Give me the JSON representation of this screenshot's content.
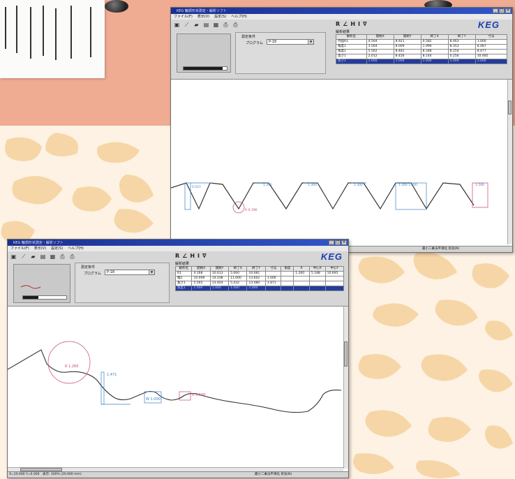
{
  "window_back": {
    "title": "KEG 輪郭形状測定・解析ソフト",
    "controls": [
      "_",
      "□",
      "×"
    ],
    "menu": [
      "ファイル(F)",
      "表示(V)",
      "設定(S)",
      "ヘルプ(H)"
    ],
    "conditions_label": "測定条件",
    "program_label": "プログラム",
    "program_value": "P-18",
    "analysis_label": "解析結果",
    "logo": "KEG",
    "tool_icons": [
      "R",
      "∠",
      "H",
      "I",
      "∇"
    ],
    "table": {
      "headers": [
        "解析名",
        "開始X",
        "開始Y",
        "終了X",
        "終了Y",
        "寸法"
      ],
      "rows": [
        [
          "円弧R1",
          "4.564",
          "8.921",
          "0.582",
          "8.463",
          "1.000"
        ],
        [
          "角度1",
          "3.564",
          "8.009",
          "1.990",
          "8.353",
          "8.487"
        ],
        [
          "角度2",
          "5.562",
          "8.481",
          "8.348",
          "8.254",
          "8.477"
        ],
        [
          "高さ1",
          "2.012",
          "8.456",
          "8.144",
          "0.256",
          "10.485"
        ],
        [
          "長さ1",
          "1.000",
          "1.000",
          "1.000",
          "1.000",
          "1.000"
        ]
      ]
    },
    "status": "最小二乗法平滑化 有効(N)",
    "labels": [
      "0.527",
      "1.300",
      "1.300",
      "1.300",
      "1.300",
      "1.500",
      "1.500",
      "R 0.196"
    ],
    "progress": 0.9
  },
  "window_front": {
    "title": "KEG 輪郭形状測定・解析ソフト",
    "controls": [
      "_",
      "□",
      "×"
    ],
    "menu": [
      "ファイル(F)",
      "表示(V)",
      "設定(S)",
      "ヘルプ(H)"
    ],
    "conditions_label": "測定条件",
    "program_label": "プログラム",
    "program_value": "P-18",
    "analysis_label": "解析結果",
    "logo": "KEG",
    "tool_icons": [
      "R",
      "∠",
      "H",
      "I",
      "∇"
    ],
    "table": {
      "headers": [
        "解析名",
        "開始X",
        "開始Y",
        "終了X",
        "終了Y",
        "寸法",
        "角度",
        "R",
        "中心X",
        "中心Y"
      ],
      "rows": [
        [
          "R1",
          "4.168",
          "10.613",
          "5.060",
          "10.681",
          "",
          "",
          "1.260",
          "5.188",
          "10.695"
        ],
        [
          "幅1",
          "10.008",
          "14.108",
          "11.000",
          "13.602",
          "1.000",
          "",
          "",
          "",
          ""
        ],
        [
          "長さ1",
          "5.565",
          "13.403",
          "5.432",
          "13.480",
          "1.871",
          "",
          "",
          "",
          ""
        ],
        [
          "角度1",
          "1.000",
          "1.000",
          "1.000",
          "1.000",
          "",
          "",
          "",
          "",
          ""
        ]
      ]
    },
    "status_left": [
      "X=10.000 Y=0.000",
      "表示: 100% (20.000 mm)"
    ],
    "status_right": "最小二乗法平滑化 有効(N)",
    "labels": [
      "R 1.260",
      "1.471",
      "W 1.000",
      "R 0.500"
    ],
    "progress": 0.35
  }
}
